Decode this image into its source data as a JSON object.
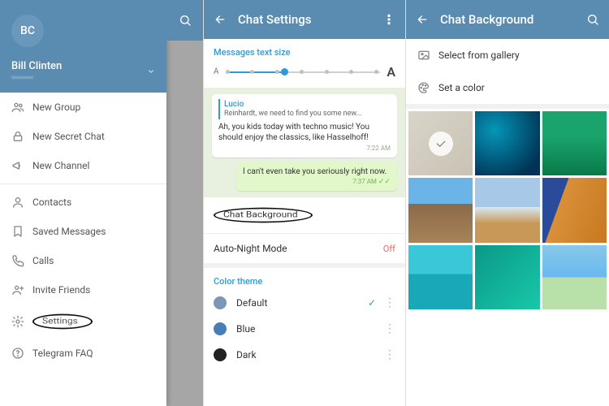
{
  "drawer": {
    "initials": "BC",
    "username": "Bill Clinten",
    "menu": [
      {
        "label": "New Group",
        "icon": "group"
      },
      {
        "label": "New Secret Chat",
        "icon": "lock"
      },
      {
        "label": "New Channel",
        "icon": "megaphone"
      }
    ],
    "menu2": [
      {
        "label": "Contacts",
        "icon": "user"
      },
      {
        "label": "Saved Messages",
        "icon": "bookmark"
      },
      {
        "label": "Calls",
        "icon": "phone"
      },
      {
        "label": "Invite Friends",
        "icon": "adduser"
      },
      {
        "label": "Settings",
        "icon": "gear",
        "circled": true
      },
      {
        "label": "Telegram FAQ",
        "icon": "help"
      }
    ]
  },
  "chatSettings": {
    "title": "Chat Settings",
    "textSizeLabel": "Messages text size",
    "preview": {
      "replyName": "Lucio",
      "replyText": "Reinhardt, we need to find you some new...",
      "inMsg": "Ah, you kids today with techno music! You should enjoy the classics, like Hasselhoff!",
      "inTime": "7:22 AM",
      "outMsg": "I can't even take you seriously right now.",
      "outTime": "7:37 AM"
    },
    "chatBackground": "Chat Background",
    "autoNight": "Auto-Night Mode",
    "autoNightVal": "Off",
    "colorThemeLabel": "Color theme",
    "themes": [
      {
        "name": "Default",
        "color": "#7a97b8",
        "checked": true
      },
      {
        "name": "Blue",
        "color": "#4a7db5"
      },
      {
        "name": "Dark",
        "color": "#222"
      }
    ]
  },
  "chatBackground": {
    "title": "Chat Background",
    "gallery": "Select from gallery",
    "setColor": "Set a color"
  }
}
